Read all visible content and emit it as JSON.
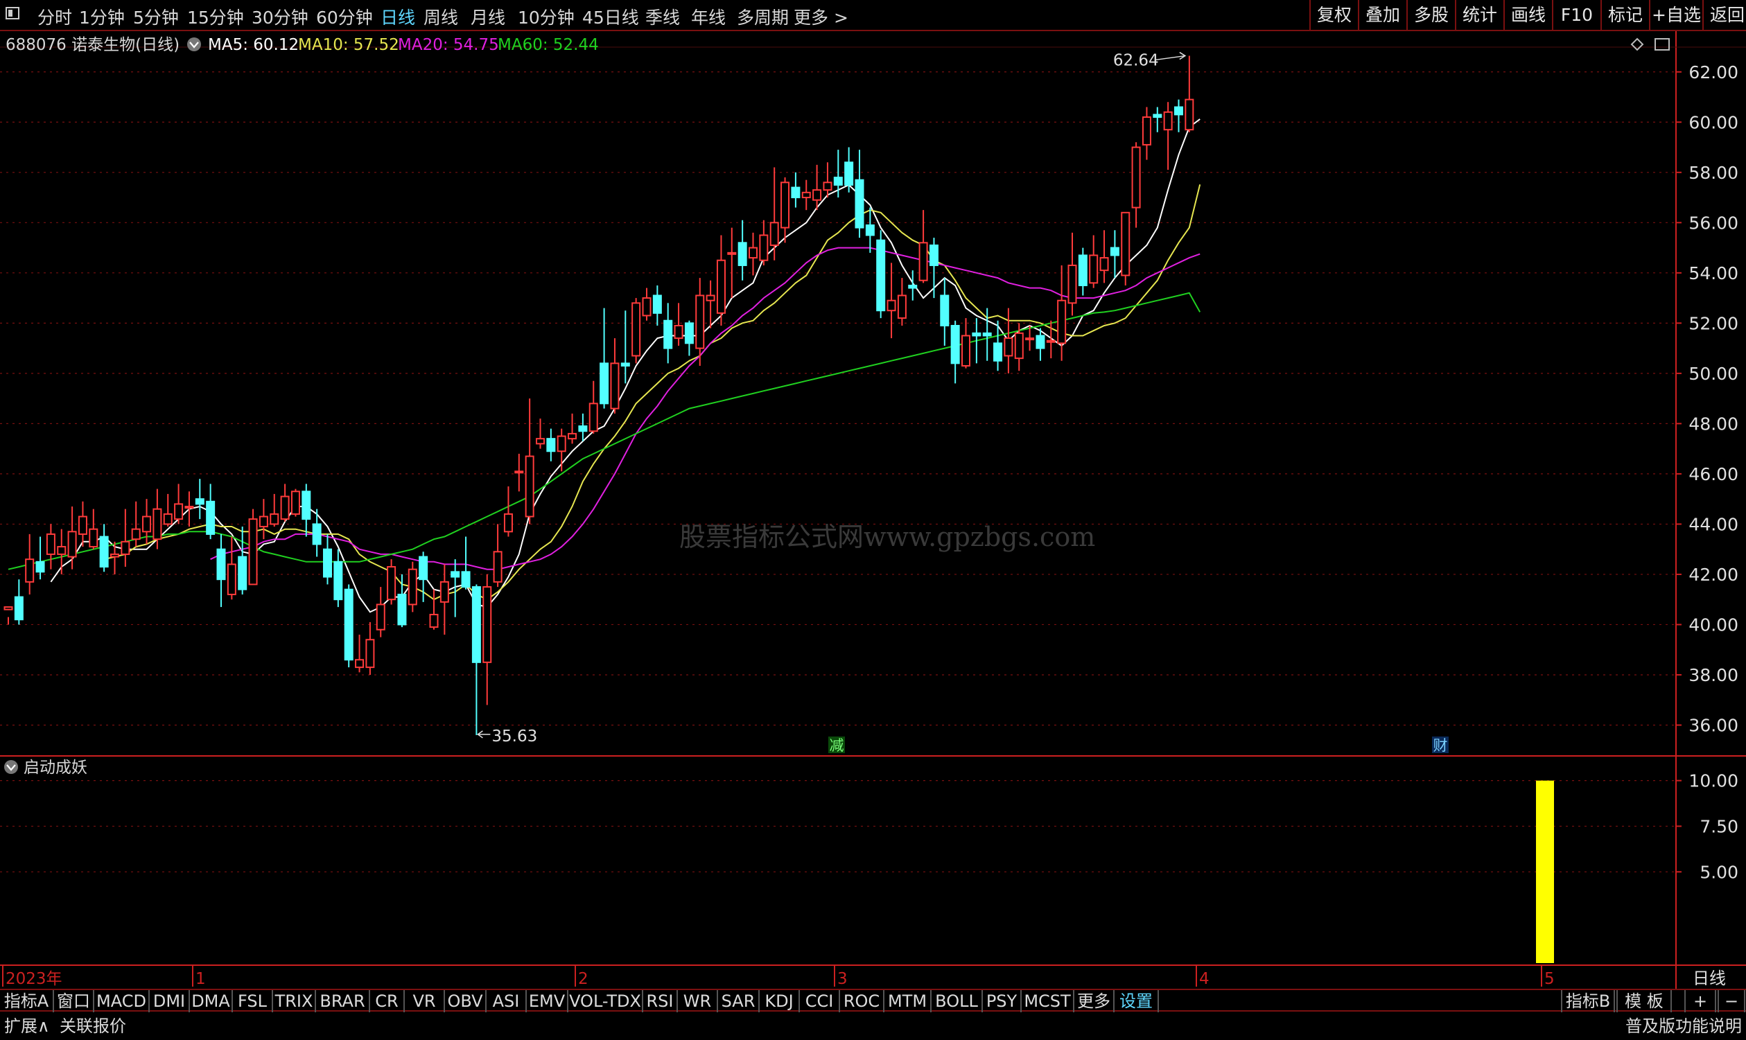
{
  "toolbar": {
    "periods": [
      "分时",
      "1分钟",
      "5分钟",
      "15分钟",
      "30分钟",
      "60分钟",
      "日线",
      "周线",
      "月线",
      "10分钟",
      "45日线",
      "季线",
      "年线",
      "多周期",
      "更多 >"
    ],
    "active_period": "日线",
    "right_buttons": [
      "复权",
      "叠加",
      "多股",
      "统计",
      "画线",
      "F10",
      "标记",
      "+自选",
      "返回"
    ]
  },
  "stock_header": {
    "title": "688076 诺泰生物(日线)",
    "ma5": "MA5: 60.12",
    "ma10": "MA10: 57.52",
    "ma20": "MA20: 54.75",
    "ma60": "MA60: 52.44"
  },
  "watermark": "股票指标公式网www.gpzbgs.com",
  "indicator_title": "启动成妖",
  "period_label": "日线",
  "colors": {
    "up": "#ff3b3b",
    "down": "#52ffff",
    "ma5": "#ffffff",
    "ma10": "#e6e650",
    "ma20": "#e020e0",
    "ma60": "#20d020",
    "grid": "#7a1010",
    "axis": "#cc2020",
    "indicator_bar": "#ffff00"
  },
  "chart_data": {
    "type": "candlestick",
    "ylim": [
      34.8,
      63.4
    ],
    "yticks": [
      "62.00",
      "60.00",
      "58.00",
      "56.00",
      "54.00",
      "52.00",
      "50.00",
      "48.00",
      "46.00",
      "44.00",
      "42.00",
      "40.00",
      "38.00",
      "36.00"
    ],
    "high_annotation": "62.64",
    "low_annotation": "35.63",
    "event_markers": [
      "减",
      "财"
    ],
    "x_axis_labels": [
      "2023年",
      "1",
      "2",
      "3",
      "4",
      "5"
    ],
    "candles": [
      [
        40.6,
        40.7,
        40.3,
        40.0
      ],
      [
        41.1,
        40.2,
        41.8,
        40.0
      ],
      [
        41.7,
        42.6,
        43.6,
        41.2
      ],
      [
        42.5,
        42.1,
        43.5,
        41.8
      ],
      [
        42.8,
        43.6,
        44.0,
        42.2
      ],
      [
        42.8,
        43.1,
        43.8,
        42.0
      ],
      [
        42.7,
        43.7,
        44.7,
        42.2
      ],
      [
        43.6,
        44.3,
        44.9,
        43.1
      ],
      [
        43.1,
        43.8,
        44.6,
        43.0
      ],
      [
        43.5,
        42.3,
        44.0,
        42.1
      ],
      [
        42.7,
        42.8,
        43.3,
        42.0
      ],
      [
        42.8,
        43.3,
        44.6,
        42.3
      ],
      [
        43.4,
        43.8,
        44.9,
        43.1
      ],
      [
        43.7,
        44.3,
        45.0,
        43.2
      ],
      [
        43.4,
        44.6,
        45.4,
        43.0
      ],
      [
        44.0,
        44.4,
        45.2,
        43.9
      ],
      [
        44.2,
        44.8,
        45.6,
        44.0
      ],
      [
        44.7,
        44.7,
        45.3,
        43.9
      ],
      [
        45.0,
        44.8,
        45.8,
        44.2
      ],
      [
        44.9,
        43.6,
        45.6,
        43.4
      ],
      [
        43.0,
        41.8,
        43.6,
        40.7
      ],
      [
        41.2,
        42.4,
        43.5,
        41.0
      ],
      [
        42.7,
        41.4,
        43.9,
        41.2
      ],
      [
        41.6,
        44.2,
        44.6,
        41.6
      ],
      [
        43.9,
        44.3,
        45.0,
        43.4
      ],
      [
        44.0,
        44.4,
        45.2,
        43.9
      ],
      [
        44.2,
        45.1,
        45.6,
        44.1
      ],
      [
        44.4,
        45.3,
        45.4,
        44.3
      ],
      [
        45.3,
        44.2,
        45.6,
        43.5
      ],
      [
        44.0,
        43.2,
        44.6,
        42.7
      ],
      [
        43.0,
        41.9,
        43.6,
        41.6
      ],
      [
        42.5,
        41.0,
        43.0,
        40.7
      ],
      [
        41.4,
        38.6,
        41.6,
        38.3
      ],
      [
        38.3,
        38.6,
        39.6,
        38.1
      ],
      [
        38.3,
        39.4,
        40.1,
        38.0
      ],
      [
        39.8,
        40.8,
        41.5,
        39.5
      ],
      [
        41.0,
        42.3,
        42.6,
        40.8
      ],
      [
        41.2,
        40.0,
        42.0,
        39.9
      ],
      [
        40.8,
        42.2,
        42.5,
        40.5
      ],
      [
        42.7,
        41.8,
        42.9,
        40.9
      ],
      [
        39.9,
        40.4,
        41.4,
        39.8
      ],
      [
        40.9,
        41.7,
        42.4,
        39.6
      ],
      [
        42.1,
        41.9,
        42.6,
        40.3
      ],
      [
        42.1,
        41.5,
        43.5,
        41.4
      ],
      [
        41.5,
        38.5,
        41.6,
        35.6
      ],
      [
        38.5,
        41.5,
        42.0,
        36.8
      ],
      [
        41.7,
        42.9,
        44.0,
        41.5
      ],
      [
        43.7,
        44.4,
        45.5,
        43.5
      ],
      [
        46.1,
        46.1,
        46.8,
        45.3
      ],
      [
        44.3,
        46.7,
        49.0,
        44.0
      ],
      [
        47.2,
        47.4,
        48.2,
        47.0
      ],
      [
        47.4,
        46.9,
        47.8,
        46.5
      ],
      [
        46.9,
        47.5,
        47.8,
        46.1
      ],
      [
        47.4,
        47.6,
        48.4,
        47.2
      ],
      [
        47.9,
        47.7,
        48.4,
        47.3
      ],
      [
        47.7,
        48.8,
        49.7,
        47.6
      ],
      [
        50.4,
        48.8,
        52.6,
        48.6
      ],
      [
        48.6,
        50.4,
        51.4,
        48.4
      ],
      [
        50.4,
        50.3,
        52.5,
        49.6
      ],
      [
        50.7,
        52.8,
        53.0,
        50.4
      ],
      [
        52.3,
        53.0,
        53.4,
        52.1
      ],
      [
        53.1,
        52.4,
        53.5,
        51.9
      ],
      [
        52.1,
        51.0,
        52.8,
        50.4
      ],
      [
        51.4,
        51.9,
        52.8,
        51.1
      ],
      [
        52.0,
        51.2,
        52.1,
        50.7
      ],
      [
        51.0,
        53.1,
        53.8,
        50.3
      ],
      [
        52.9,
        53.1,
        53.7,
        51.8
      ],
      [
        52.4,
        54.5,
        55.5,
        51.9
      ],
      [
        54.8,
        54.8,
        55.8,
        53.0
      ],
      [
        55.2,
        54.3,
        56.1,
        53.7
      ],
      [
        54.6,
        55.0,
        55.6,
        53.9
      ],
      [
        54.5,
        55.5,
        56.1,
        54.3
      ],
      [
        55.1,
        56.0,
        58.2,
        54.5
      ],
      [
        55.8,
        57.6,
        57.8,
        55.2
      ],
      [
        57.4,
        57.0,
        58.0,
        56.6
      ],
      [
        57.0,
        57.2,
        57.7,
        56.5
      ],
      [
        56.9,
        57.3,
        58.3,
        56.5
      ],
      [
        57.3,
        57.6,
        58.4,
        57.0
      ],
      [
        57.8,
        57.5,
        58.9,
        57.0
      ],
      [
        58.4,
        57.5,
        59.0,
        57.2
      ],
      [
        57.7,
        55.8,
        58.9,
        55.4
      ],
      [
        55.9,
        55.5,
        56.6,
        54.8
      ],
      [
        55.3,
        52.5,
        55.7,
        52.2
      ],
      [
        52.5,
        52.9,
        54.4,
        51.4
      ],
      [
        52.2,
        53.1,
        53.8,
        51.9
      ],
      [
        53.5,
        53.4,
        54.1,
        52.9
      ],
      [
        53.7,
        55.2,
        56.5,
        53.6
      ],
      [
        55.1,
        54.3,
        55.4,
        53.0
      ],
      [
        53.1,
        51.9,
        53.8,
        51.1
      ],
      [
        51.9,
        50.4,
        52.1,
        49.6
      ],
      [
        50.3,
        51.5,
        52.2,
        50.2
      ],
      [
        51.6,
        51.5,
        52.2,
        50.4
      ],
      [
        51.6,
        51.5,
        52.6,
        50.5
      ],
      [
        51.2,
        50.5,
        52.1,
        50.1
      ],
      [
        50.7,
        51.4,
        52.6,
        50.0
      ],
      [
        50.6,
        51.6,
        52.0,
        50.1
      ],
      [
        51.4,
        51.4,
        51.9,
        50.9
      ],
      [
        51.5,
        51.0,
        51.8,
        50.5
      ],
      [
        51.3,
        51.3,
        52.1,
        50.6
      ],
      [
        51.2,
        52.9,
        54.3,
        50.5
      ],
      [
        52.8,
        54.3,
        55.6,
        52.3
      ],
      [
        54.7,
        53.5,
        55.0,
        53.1
      ],
      [
        53.6,
        54.7,
        55.5,
        53.4
      ],
      [
        54.1,
        54.6,
        55.7,
        53.6
      ],
      [
        55.0,
        54.7,
        55.7,
        53.8
      ],
      [
        53.9,
        56.4,
        56.4,
        53.5
      ],
      [
        56.6,
        59.0,
        59.2,
        55.8
      ],
      [
        59.1,
        60.2,
        60.6,
        58.5
      ],
      [
        60.3,
        60.2,
        60.6,
        59.6
      ],
      [
        59.7,
        60.4,
        60.8,
        58.1
      ],
      [
        60.6,
        60.3,
        60.9,
        59.6
      ],
      [
        59.7,
        60.9,
        62.64,
        59.6
      ]
    ],
    "ma_series": [
      {
        "name": "MA5",
        "values": [
          null,
          null,
          null,
          null,
          41.7,
          42.3,
          42.6,
          43.3,
          43.3,
          43.5,
          43.1,
          43.0,
          43.0,
          43.0,
          43.4,
          43.8,
          44.2,
          44.6,
          44.7,
          44.5,
          44.0,
          43.6,
          42.9,
          42.8,
          43.2,
          43.3,
          44.1,
          44.7,
          44.7,
          44.4,
          43.9,
          43.1,
          42.1,
          41.1,
          40.5,
          40.7,
          41.1,
          41.1,
          41.7,
          42.0,
          41.4,
          41.3,
          41.5,
          41.6,
          40.8,
          40.7,
          41.2,
          41.9,
          42.8,
          44.4,
          45.2,
          45.9,
          46.4,
          46.9,
          47.3,
          47.7,
          47.9,
          48.6,
          49.4,
          50.3,
          50.9,
          51.4,
          51.5,
          51.5,
          51.5,
          51.5,
          51.9,
          52.3,
          53.0,
          53.3,
          53.6,
          54.6,
          55.0,
          55.4,
          55.7,
          56.0,
          56.6,
          57.1,
          57.3,
          57.5,
          57.1,
          56.7,
          55.8,
          55.2,
          54.3,
          53.6,
          53.0,
          53.4,
          53.8,
          53.5,
          52.6,
          52.3,
          52.1,
          51.9,
          51.3,
          51.7,
          51.9,
          51.7,
          51.4,
          51.1,
          51.5,
          52.3,
          52.5,
          53.2,
          53.8,
          54.3,
          54.7,
          55.1,
          55.8,
          57.3,
          58.7,
          59.8,
          60.12
        ]
      },
      {
        "name": "MA10",
        "values": [
          null,
          null,
          null,
          null,
          null,
          null,
          null,
          null,
          null,
          42.6,
          42.7,
          42.8,
          43.1,
          43.2,
          43.4,
          43.5,
          43.6,
          43.8,
          43.9,
          44.0,
          43.9,
          43.9,
          43.7,
          43.7,
          43.8,
          43.6,
          43.8,
          43.8,
          43.7,
          43.6,
          43.6,
          43.6,
          43.4,
          42.8,
          42.5,
          42.3,
          42.1,
          41.6,
          41.5,
          41.3,
          41.0,
          41.2,
          41.3,
          41.6,
          41.2,
          41.0,
          41.3,
          41.7,
          42.2,
          42.6,
          43.0,
          43.3,
          43.9,
          44.7,
          45.7,
          46.4,
          47.0,
          47.5,
          48.1,
          48.8,
          49.2,
          49.6,
          50.0,
          50.2,
          50.5,
          50.7,
          51.2,
          51.4,
          51.8,
          52.0,
          52.1,
          52.5,
          52.8,
          53.2,
          53.6,
          53.9,
          54.6,
          55.3,
          55.6,
          56.0,
          56.3,
          56.5,
          56.4,
          56.0,
          55.6,
          55.3,
          55.1,
          54.5,
          54.3,
          53.7,
          53.0,
          52.6,
          52.2,
          52.3,
          52.1,
          52.1,
          52.1,
          52.0,
          51.8,
          51.6,
          51.5,
          51.5,
          51.7,
          51.9,
          52.0,
          52.2,
          52.7,
          53.2,
          53.7,
          54.5,
          55.2,
          55.8,
          57.52
        ]
      },
      {
        "name": "MA20",
        "values": [
          null,
          null,
          null,
          null,
          null,
          null,
          null,
          null,
          null,
          null,
          null,
          null,
          null,
          null,
          null,
          null,
          null,
          null,
          null,
          42.6,
          42.8,
          42.9,
          43.0,
          43.1,
          43.3,
          43.4,
          43.4,
          43.6,
          43.6,
          43.6,
          43.5,
          43.4,
          43.3,
          43.0,
          42.9,
          42.8,
          42.8,
          42.7,
          42.6,
          42.5,
          42.5,
          42.4,
          42.4,
          42.4,
          42.3,
          42.2,
          42.2,
          42.3,
          42.4,
          42.5,
          42.6,
          42.8,
          43.1,
          43.5,
          44.0,
          44.6,
          45.3,
          46.0,
          46.8,
          47.6,
          48.2,
          48.7,
          49.3,
          49.8,
          50.3,
          50.7,
          51.2,
          51.6,
          51.9,
          52.3,
          52.6,
          53.0,
          53.3,
          53.6,
          54.0,
          54.4,
          54.7,
          54.9,
          55.0,
          55.0,
          55.0,
          55.0,
          54.9,
          54.8,
          54.7,
          54.6,
          54.5,
          54.4,
          54.3,
          54.2,
          54.1,
          54.0,
          53.9,
          53.8,
          53.6,
          53.5,
          53.4,
          53.4,
          53.3,
          53.1,
          53.0,
          53.0,
          53.0,
          53.1,
          53.2,
          53.3,
          53.5,
          53.8,
          54.0,
          54.2,
          54.4,
          54.6,
          54.75
        ]
      },
      {
        "name": "MA60",
        "values": [
          42.2,
          42.3,
          42.4,
          42.5,
          42.6,
          42.7,
          42.8,
          42.9,
          43.0,
          43.1,
          43.2,
          43.3,
          43.4,
          43.5,
          43.5,
          43.6,
          43.6,
          43.7,
          43.7,
          43.7,
          43.6,
          43.5,
          43.3,
          43.1,
          42.9,
          42.8,
          42.7,
          42.6,
          42.5,
          42.5,
          42.5,
          42.5,
          42.5,
          42.5,
          42.6,
          42.7,
          42.8,
          42.9,
          43.0,
          43.2,
          43.4,
          43.5,
          43.7,
          43.9,
          44.1,
          44.3,
          44.5,
          44.7,
          44.9,
          45.1,
          45.4,
          45.7,
          46.0,
          46.3,
          46.6,
          46.8,
          47.0,
          47.2,
          47.4,
          47.6,
          47.8,
          48.0,
          48.2,
          48.4,
          48.6,
          48.7,
          48.8,
          48.9,
          49.0,
          49.1,
          49.2,
          49.3,
          49.4,
          49.5,
          49.6,
          49.7,
          49.8,
          49.9,
          50.0,
          50.1,
          50.2,
          50.3,
          50.4,
          50.5,
          50.6,
          50.7,
          50.8,
          50.9,
          51.0,
          51.1,
          51.2,
          51.3,
          51.4,
          51.5,
          51.6,
          51.7,
          51.8,
          51.9,
          52.0,
          52.1,
          52.2,
          52.3,
          52.4,
          52.44,
          52.5,
          52.6,
          52.7,
          52.8,
          52.9,
          53.0,
          53.1,
          53.2,
          52.44
        ]
      }
    ],
    "indicator": {
      "ylim": [
        0,
        11.2
      ],
      "yticks": [
        "10.00",
        "7.50",
        "5.00"
      ],
      "bars": [
        {
          "index": 110,
          "value": 10.0
        }
      ]
    }
  },
  "bottom_tabs": [
    "指标A",
    "窗口",
    "MACD",
    "DMI",
    "DMA",
    "FSL",
    "TRIX",
    "BRAR",
    "CR",
    "VR",
    "OBV",
    "ASI",
    "EMV",
    "VOL-TDX",
    "RSI",
    "WR",
    "SAR",
    "KDJ",
    "CCI",
    "ROC",
    "MTM",
    "BOLL",
    "PSY",
    "MCST",
    "更多",
    "设置"
  ],
  "bottom_right": [
    "指标B",
    "模 板",
    "+",
    "−"
  ],
  "status_bar": {
    "left": [
      "扩展∧",
      "关联报价"
    ],
    "right": "普及版功能说明"
  }
}
